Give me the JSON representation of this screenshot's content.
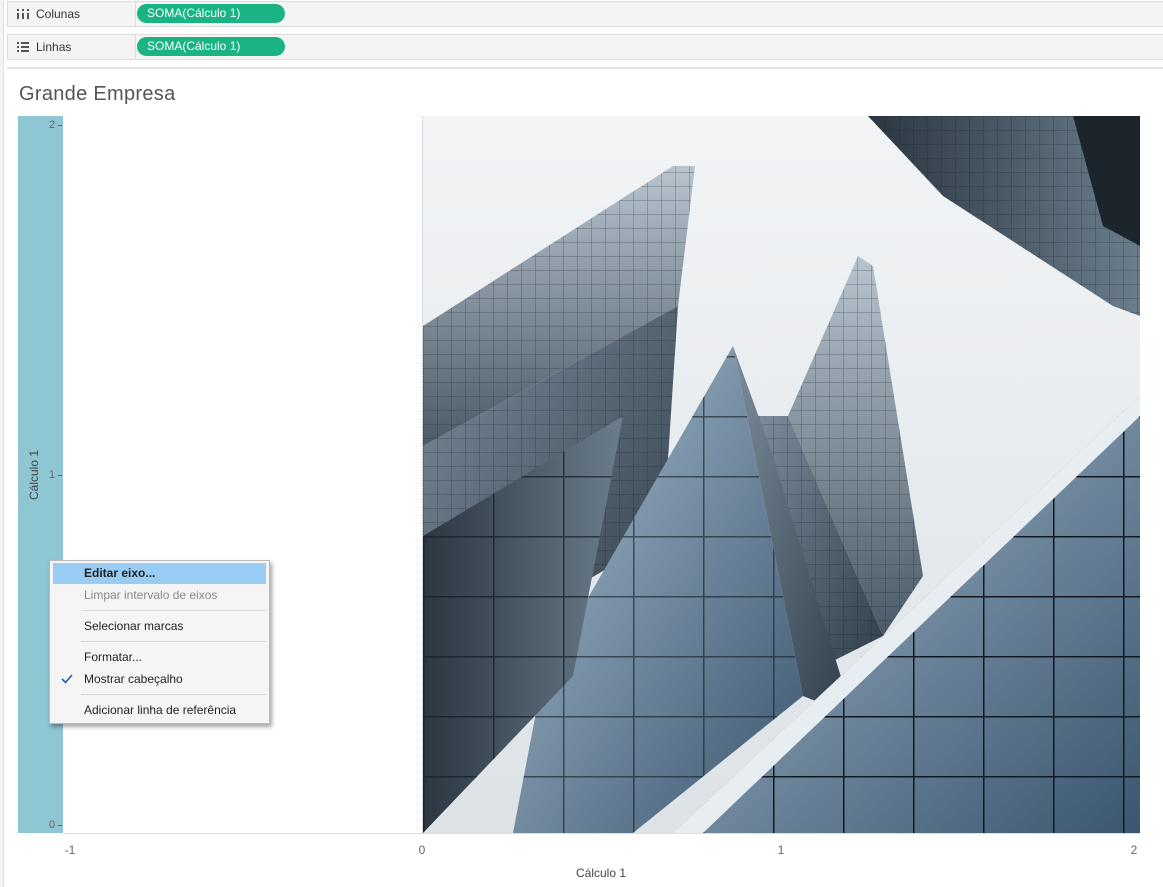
{
  "shelves": {
    "columns": {
      "label": "Colunas",
      "icon": "columns-icon",
      "pill": "SOMA(Cálculo 1)"
    },
    "rows": {
      "label": "Linhas",
      "icon": "rows-list-icon",
      "pill": "SOMA(Cálculo 1)"
    }
  },
  "view": {
    "title": "Grande Empresa",
    "background_image": "glass-skyscrapers-photo"
  },
  "axes": {
    "y": {
      "title": "Cálculo 1",
      "ticks": [
        "2",
        "1",
        "0"
      ]
    },
    "x": {
      "title": "Cálculo 1",
      "ticks": [
        "-1",
        "0",
        "1",
        "2"
      ]
    }
  },
  "context_menu": {
    "items": [
      {
        "label": "Editar eixo...",
        "state": "highlighted"
      },
      {
        "label": "Limpar intervalo de eixos",
        "state": "disabled"
      },
      {
        "label": "Selecionar marcas",
        "state": "normal"
      },
      {
        "label": "Formatar...",
        "state": "normal"
      },
      {
        "label": "Mostrar cabeçalho",
        "state": "checked"
      },
      {
        "label": "Adicionar linha de referência",
        "state": "normal"
      }
    ]
  },
  "colors": {
    "pill": "#19b384",
    "axis_band": "#8ec6d3",
    "menu_highlight": "#99ccf2"
  }
}
